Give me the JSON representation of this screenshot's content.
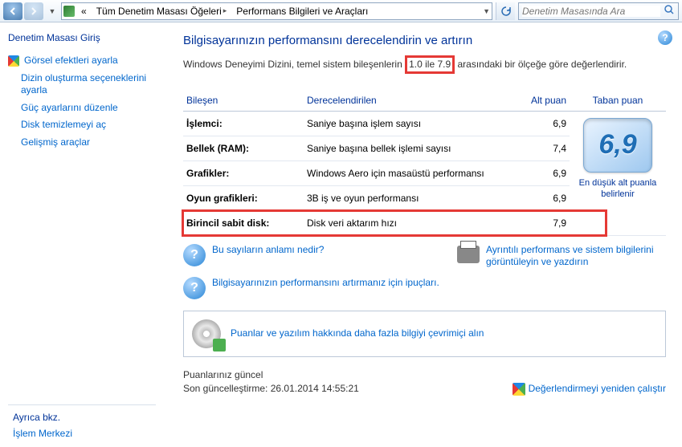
{
  "titlebar": {
    "breadcrumb": [
      "Tüm Denetim Masası Öğeleri",
      "Performans Bilgileri ve Araçları"
    ],
    "search_placeholder": "Denetim Masasında Ara",
    "back_chev": "«"
  },
  "sidebar": {
    "home": "Denetim Masası Giriş",
    "links": [
      "Görsel efektleri ayarla",
      "Dizin oluşturma seçeneklerini ayarla",
      "Güç ayarlarını düzenle",
      "Disk temizlemeyi aç",
      "Gelişmiş araçlar"
    ],
    "seealso_title": "Ayrıca bkz.",
    "seealso": "İşlem Merkezi"
  },
  "main": {
    "heading": "Bilgisayarınızın performansını derecelendirin ve artırın",
    "intro_pre": "Windows Deneyimi Dizini, temel sistem bileşenlerin ",
    "intro_range": "1.0 ile 7.9",
    "intro_post": " arasındaki bir ölçeğe göre değerlendirir.",
    "columns": {
      "comp": "Bileşen",
      "rated": "Derecelendirilen",
      "sub": "Alt puan",
      "base": "Taban puan"
    },
    "rows": [
      {
        "comp": "İşlemci:",
        "rated": "Saniye başına işlem sayısı",
        "sub": "6,9"
      },
      {
        "comp": "Bellek (RAM):",
        "rated": "Saniye başına bellek işlemi sayısı",
        "sub": "7,4"
      },
      {
        "comp": "Grafikler:",
        "rated": "Windows Aero için masaüstü performansı",
        "sub": "6,9"
      },
      {
        "comp": "Oyun grafikleri:",
        "rated": "3B iş ve oyun performansı",
        "sub": "6,9"
      },
      {
        "comp": "Birincil sabit disk:",
        "rated": "Disk veri aktarım hızı",
        "sub": "7,9"
      }
    ],
    "base_score": "6,9",
    "base_caption": "En düşük alt puanla belirlenir",
    "links": {
      "q1": "Bu sayıların anlamı nedir?",
      "q2": "Bilgisayarınızın performansını artırmanız için ipuçları.",
      "print": "Ayrıntılı performans ve sistem bilgilerini görüntüleyin ve yazdırın",
      "online": "Puanlar ve yazılım hakkında daha fazla bilgiyi çevrimiçi alın"
    },
    "status_line1": "Puanlarınız güncel",
    "status_line2": "Son güncelleştirme: 26.01.2014 14:55:21",
    "rerun": "Değerlendirmeyi yeniden çalıştır"
  }
}
